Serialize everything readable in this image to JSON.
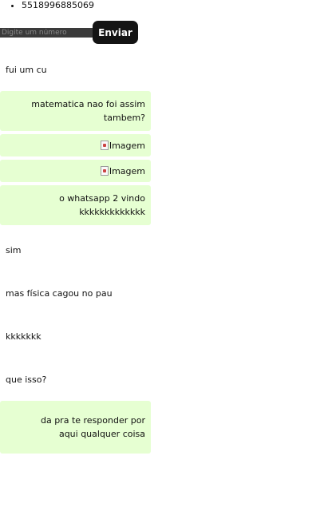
{
  "contacts": [
    "5518996885069"
  ],
  "compose": {
    "placeholder": "Digite um número",
    "value": "",
    "send_label": "Enviar"
  },
  "messages": [
    {
      "type": "recv",
      "text": "fui um cu"
    },
    {
      "type": "sent",
      "text": "matematica nao foi assim tambem?"
    },
    {
      "type": "sent-image",
      "alt": "Imagem"
    },
    {
      "type": "sent-image",
      "alt": "Imagem"
    },
    {
      "type": "sent",
      "text": "o whatsapp 2 vindo kkkkkkkkkkkkk"
    },
    {
      "type": "recv",
      "text": "sim"
    },
    {
      "type": "recv",
      "text": "mas física cagou no pau"
    },
    {
      "type": "recv",
      "text": "kkkkkkk"
    },
    {
      "type": "recv",
      "text": "que isso?"
    },
    {
      "type": "sent",
      "text": "da pra te responder por aqui qualquer coisa"
    }
  ],
  "colors": {
    "sent_bubble": "#e6ffd2",
    "send_button": "#141414",
    "input_bg": "#3a3a3a"
  }
}
